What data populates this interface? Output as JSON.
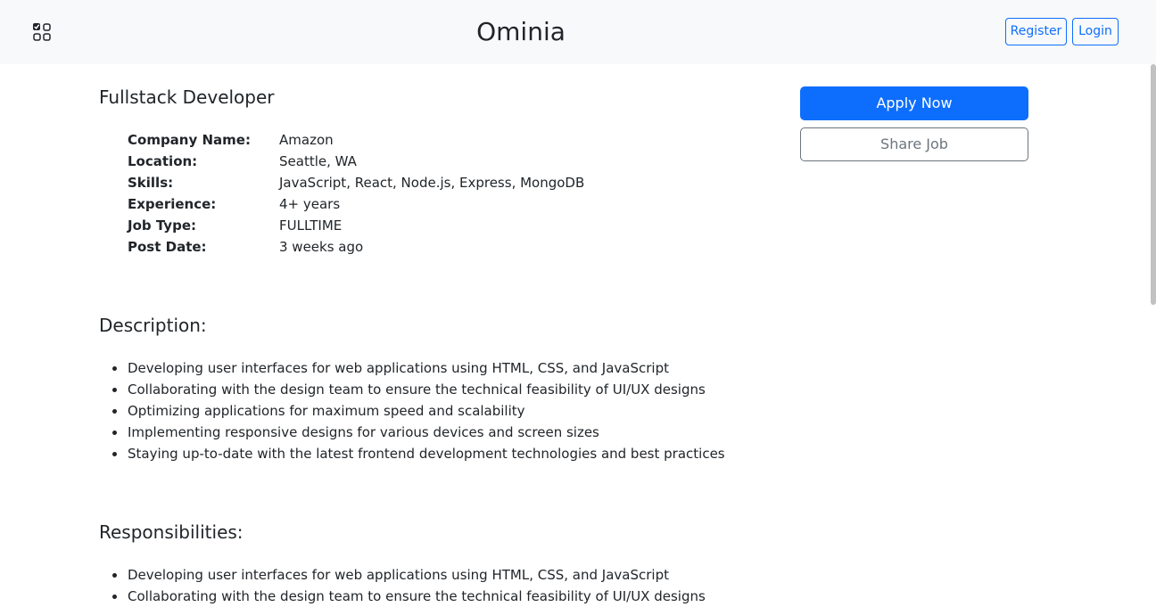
{
  "header": {
    "brand": "Ominia",
    "register_label": "Register",
    "login_label": "Login",
    "logo_icon": "tasks-checklist-icon"
  },
  "job": {
    "title": "Fullstack Developer",
    "details": [
      {
        "label": "Company Name:",
        "value": "Amazon"
      },
      {
        "label": "Location:",
        "value": "Seattle, WA"
      },
      {
        "label": "Skills:",
        "value": "JavaScript, React, Node.js, Express, MongoDB"
      },
      {
        "label": "Experience:",
        "value": "4+ years"
      },
      {
        "label": "Job Type:",
        "value": "FULLTIME"
      },
      {
        "label": "Post Date:",
        "value": "3 weeks ago"
      }
    ]
  },
  "actions": {
    "apply_label": "Apply Now",
    "share_label": "Share Job"
  },
  "description": {
    "heading": "Description:",
    "items": [
      "Developing user interfaces for web applications using HTML, CSS, and JavaScript",
      "Collaborating with the design team to ensure the technical feasibility of UI/UX designs",
      "Optimizing applications for maximum speed and scalability",
      "Implementing responsive designs for various devices and screen sizes",
      "Staying up-to-date with the latest frontend development technologies and best practices"
    ]
  },
  "responsibilities": {
    "heading": "Responsibilities:",
    "items": [
      "Developing user interfaces for web applications using HTML, CSS, and JavaScript",
      "Collaborating with the design team to ensure the technical feasibility of UI/UX designs"
    ]
  },
  "colors": {
    "primary": "#0d6efd",
    "secondary": "#6c757d",
    "navbar_bg": "#f8f9fa",
    "text": "#212529"
  }
}
